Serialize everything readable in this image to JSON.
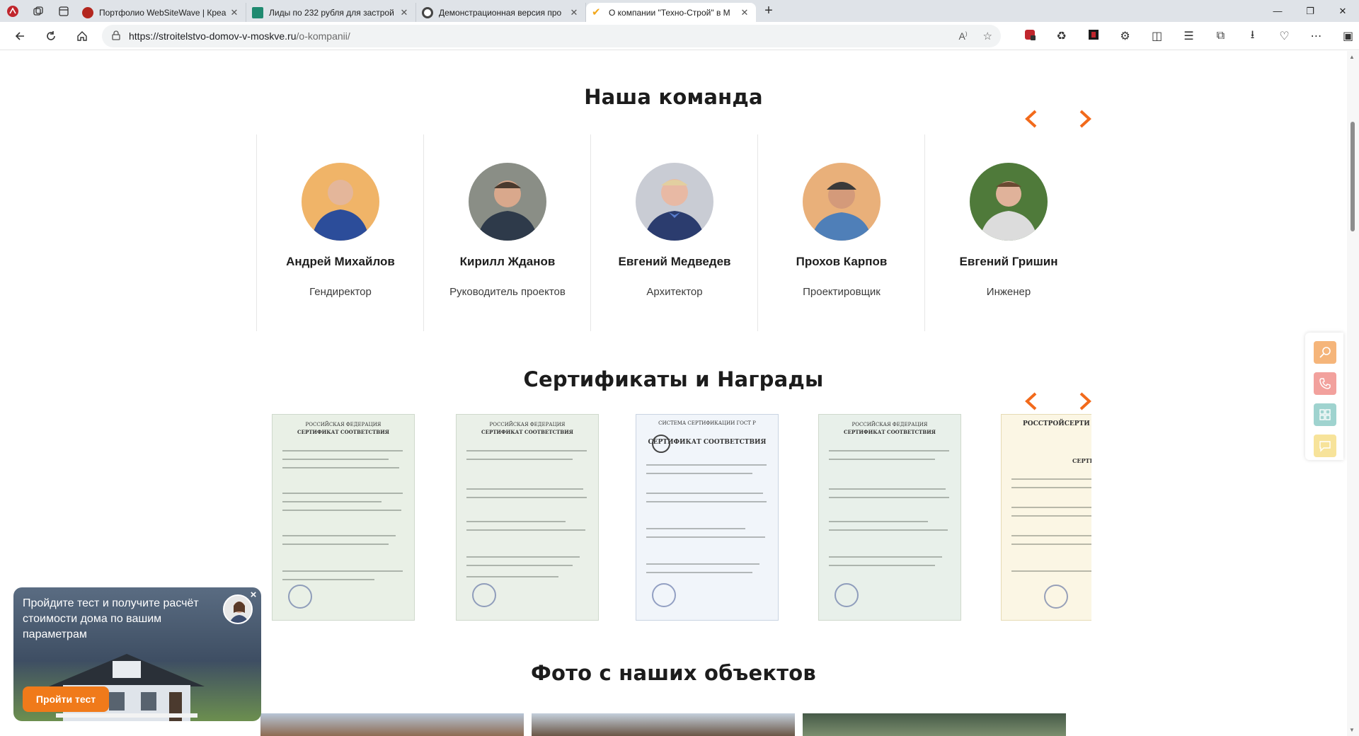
{
  "browser": {
    "tabs": [
      {
        "title": "Портфолио WebSiteWave | Креа",
        "fav_color": "#b3261e"
      },
      {
        "title": "Лиды по 232 рубля для застрой",
        "fav_color": "#1f8a70"
      },
      {
        "title": "Демонстрационная версия про",
        "fav_color": "#444444"
      },
      {
        "title": "О компании \"Техно-Строй\" в М",
        "fav_color": "#f2a71b"
      }
    ],
    "url_host": "https://stroitelstvo-domov-v-moskve.ru",
    "url_path": "/o-kompanii/"
  },
  "team": {
    "title": "Наша команда",
    "members": [
      {
        "name": "Андрей Михайлов",
        "role": "Гендиректор"
      },
      {
        "name": "Кирилл Жданов",
        "role": "Руководитель проектов"
      },
      {
        "name": "Евгений Медведев",
        "role": "Архитектор"
      },
      {
        "name": "Прохов Карпов",
        "role": "Проектировщик"
      },
      {
        "name": "Евгений Гришин",
        "role": "Инженер"
      }
    ]
  },
  "certificates": {
    "title": "Сертификаты и Награды",
    "items": [
      {
        "header": "РОССИЙСКАЯ ФЕДЕРАЦИЯ",
        "sub": "СЕРТИФИКАТ СООТВЕТСТВИЯ",
        "bg": "#e9f0e6"
      },
      {
        "header": "РОССИЙСКАЯ ФЕДЕРАЦИЯ",
        "sub": "СЕРТИФИКАТ СООТВЕТСТВИЯ",
        "bg": "#eaf0e8"
      },
      {
        "header": "СИСТЕМА СЕРТИФИКАЦИИ ГОСТ Р",
        "sub": "СЕРТИФИКАТ СООТВЕТСТВИЯ",
        "bg": "#f1f5fa"
      },
      {
        "header": "РОССИЙСКАЯ ФЕДЕРАЦИЯ",
        "sub": "СЕРТИФИКАТ СООТВЕТСТВИЯ",
        "bg": "#e8f0ea"
      },
      {
        "header": "РОССТРОЙСЕРТИ",
        "sub": "СЕРТИФИКАТ СОО",
        "bg": "#fbf6e4"
      }
    ]
  },
  "photos": {
    "title": "Фото с наших объектов"
  },
  "quiz": {
    "text": "Пройдите тест и получите расчёт стоимости дома по вашим параметрам",
    "button": "Пройти тест",
    "close": "×"
  },
  "colors": {
    "accent": "#f26a1b",
    "search_btn": "#f5b57a",
    "phone_btn": "#f2a19d",
    "grid_btn": "#9fd3cf",
    "chat_btn": "#f7e39a"
  }
}
